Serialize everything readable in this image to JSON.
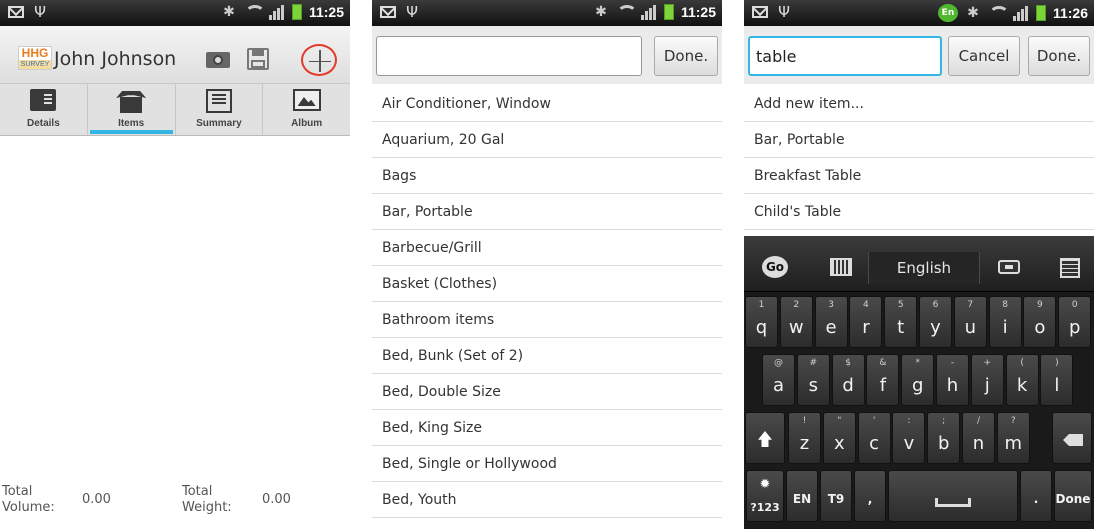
{
  "status": {
    "time_1": "11:25",
    "time_2": "11:25",
    "time_3": "11:26",
    "en_badge": "En"
  },
  "app": {
    "logo_line1": "HHG",
    "logo_line2": "SURVEY",
    "customer_name": "John Johnson",
    "icons": [
      "camera-icon",
      "save-icon",
      "add-icon"
    ],
    "tabs": [
      {
        "label": "Details",
        "icon": "details-icon"
      },
      {
        "label": "Items",
        "icon": "items-icon",
        "active": true
      },
      {
        "label": "Summary",
        "icon": "summary-icon"
      },
      {
        "label": "Album",
        "icon": "album-icon"
      }
    ],
    "totals": {
      "volume_label_1": "Total",
      "volume_label_2": "Volume:",
      "volume_value": "0.00",
      "weight_label_1": "Total",
      "weight_label_2": "Weight:",
      "weight_value": "0.00"
    },
    "accent_color": "#33b5e5",
    "add_circle_color": "#e23a2c"
  },
  "picker": {
    "search_value": "",
    "done_label": "Done.",
    "items": [
      "Air Conditioner, Window",
      "Aquarium, 20 Gal",
      "Bags",
      "Bar, Portable",
      "Barbecue/Grill",
      "Basket (Clothes)",
      "Bathroom items",
      "Bed, Bunk (Set of 2)",
      "Bed, Double Size",
      "Bed, King Size",
      "Bed, Single or Hollywood",
      "Bed, Youth"
    ]
  },
  "search": {
    "search_value": "table",
    "cancel_label": "Cancel",
    "done_label": "Done.",
    "results": [
      "Add new item...",
      "Bar, Portable",
      "Breakfast Table",
      "Child's Table"
    ]
  },
  "keyboard": {
    "language": "English",
    "go_label": "Go",
    "row1": [
      {
        "k": "q",
        "s": "1"
      },
      {
        "k": "w",
        "s": "2"
      },
      {
        "k": "e",
        "s": "3"
      },
      {
        "k": "r",
        "s": "4"
      },
      {
        "k": "t",
        "s": "5"
      },
      {
        "k": "y",
        "s": "6"
      },
      {
        "k": "u",
        "s": "7"
      },
      {
        "k": "i",
        "s": "8"
      },
      {
        "k": "o",
        "s": "9"
      },
      {
        "k": "p",
        "s": "0"
      }
    ],
    "row2": [
      {
        "k": "a",
        "s": "@"
      },
      {
        "k": "s",
        "s": "#"
      },
      {
        "k": "d",
        "s": "$"
      },
      {
        "k": "f",
        "s": "&"
      },
      {
        "k": "g",
        "s": "*"
      },
      {
        "k": "h",
        "s": "-"
      },
      {
        "k": "j",
        "s": "+"
      },
      {
        "k": "k",
        "s": "("
      },
      {
        "k": "l",
        "s": ")"
      }
    ],
    "row3": [
      {
        "k": "z",
        "s": "!"
      },
      {
        "k": "x",
        "s": "\""
      },
      {
        "k": "c",
        "s": "'"
      },
      {
        "k": "v",
        "s": ":"
      },
      {
        "k": "b",
        "s": ";"
      },
      {
        "k": "n",
        "s": "/"
      },
      {
        "k": "m",
        "s": "?"
      }
    ],
    "sym_label": "?123",
    "en_label": "EN",
    "t9_label": "T9",
    "comma_label": ",",
    "period_label": ".",
    "done_label": "Done"
  }
}
